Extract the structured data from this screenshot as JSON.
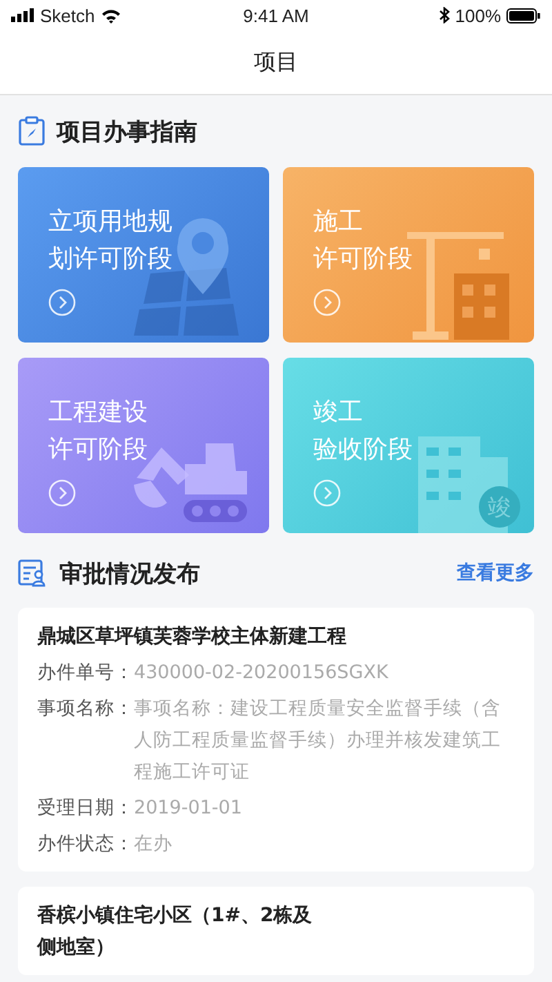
{
  "status_bar": {
    "carrier": "Sketch",
    "time": "9:41 AM",
    "battery": "100%"
  },
  "nav": {
    "title": "项目"
  },
  "guide": {
    "title": "项目办事指南",
    "cards": [
      {
        "kind": "map",
        "lines": [
          "立项用地规",
          "划许可阶段"
        ]
      },
      {
        "kind": "crane",
        "lines": [
          "施工",
          "许可阶段"
        ]
      },
      {
        "kind": "excavator",
        "lines": [
          "工程建设",
          "许可阶段"
        ]
      },
      {
        "kind": "building",
        "lines": [
          "竣工",
          "验收阶段"
        ],
        "badge": "竣"
      }
    ]
  },
  "approvals": {
    "title": "审批情况发布",
    "more": "查看更多",
    "items": [
      {
        "title_lines": [
          "鼎城区草坪镇芙蓉学校主体新建工程"
        ],
        "fields": [
          {
            "label": "办件单号：",
            "value": "430000-02-20200156SGXK"
          },
          {
            "label": "事项名称：",
            "value": "事项名称：建设工程质量安全监督手续（含人防工程质量监督手续）办理并核发建筑工程施工许可证"
          },
          {
            "label": "受理日期：",
            "value": "2019-01-01"
          },
          {
            "label": "办件状态：",
            "value": "在办"
          }
        ]
      },
      {
        "title_lines": [
          "香槟小镇住宅小区（1#、2栋及",
          "侧地室）"
        ]
      }
    ]
  }
}
